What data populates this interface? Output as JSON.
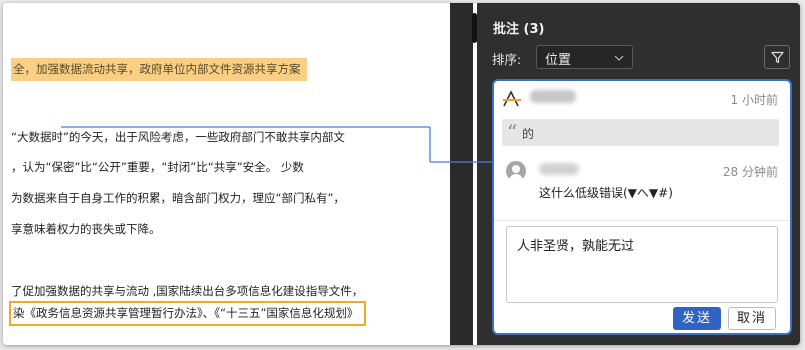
{
  "document": {
    "lines": [
      "全，加强数据流动共享，政府单位内部文件资源共享方案",
      "“大数据时”的今天，出于风险考虑，一些政府部门不敢共享内部文",
      "，认为“保密”比“公开”重要，“封闭”比“共享”安全。 少数",
      "为数据来自于自身工作的积累，暗含部门权力，理应“部门私有”，",
      "享意味着权力的丧失或下降。",
      "了促加强数据的共享与流动 ,国家陆续出台多项信息化建设指导文件，",
      "染《政务信息资源共享管理暂行办法》、《“十三五”国家信息化规划》"
    ]
  },
  "comments_panel": {
    "title": "批注 (3)",
    "sort_label": "排序:",
    "sort_value": "位置",
    "filter_icon": "filter-icon",
    "active_comment": {
      "author_icon": "text-annotation-icon",
      "time": "1 小时前",
      "quote": "的",
      "reply": {
        "time": "28 分钟前",
        "text": "这什么低级错误(▼へ▼#)"
      },
      "reply_input_value": "人非圣贤，孰能无过",
      "send_label": "发送",
      "cancel_label": "取消"
    }
  },
  "colors": {
    "highlight": "#f9cf83",
    "box_border": "#f0a92a",
    "accent_blue": "#2f64c4",
    "pane_bg": "#2f2f2f"
  }
}
